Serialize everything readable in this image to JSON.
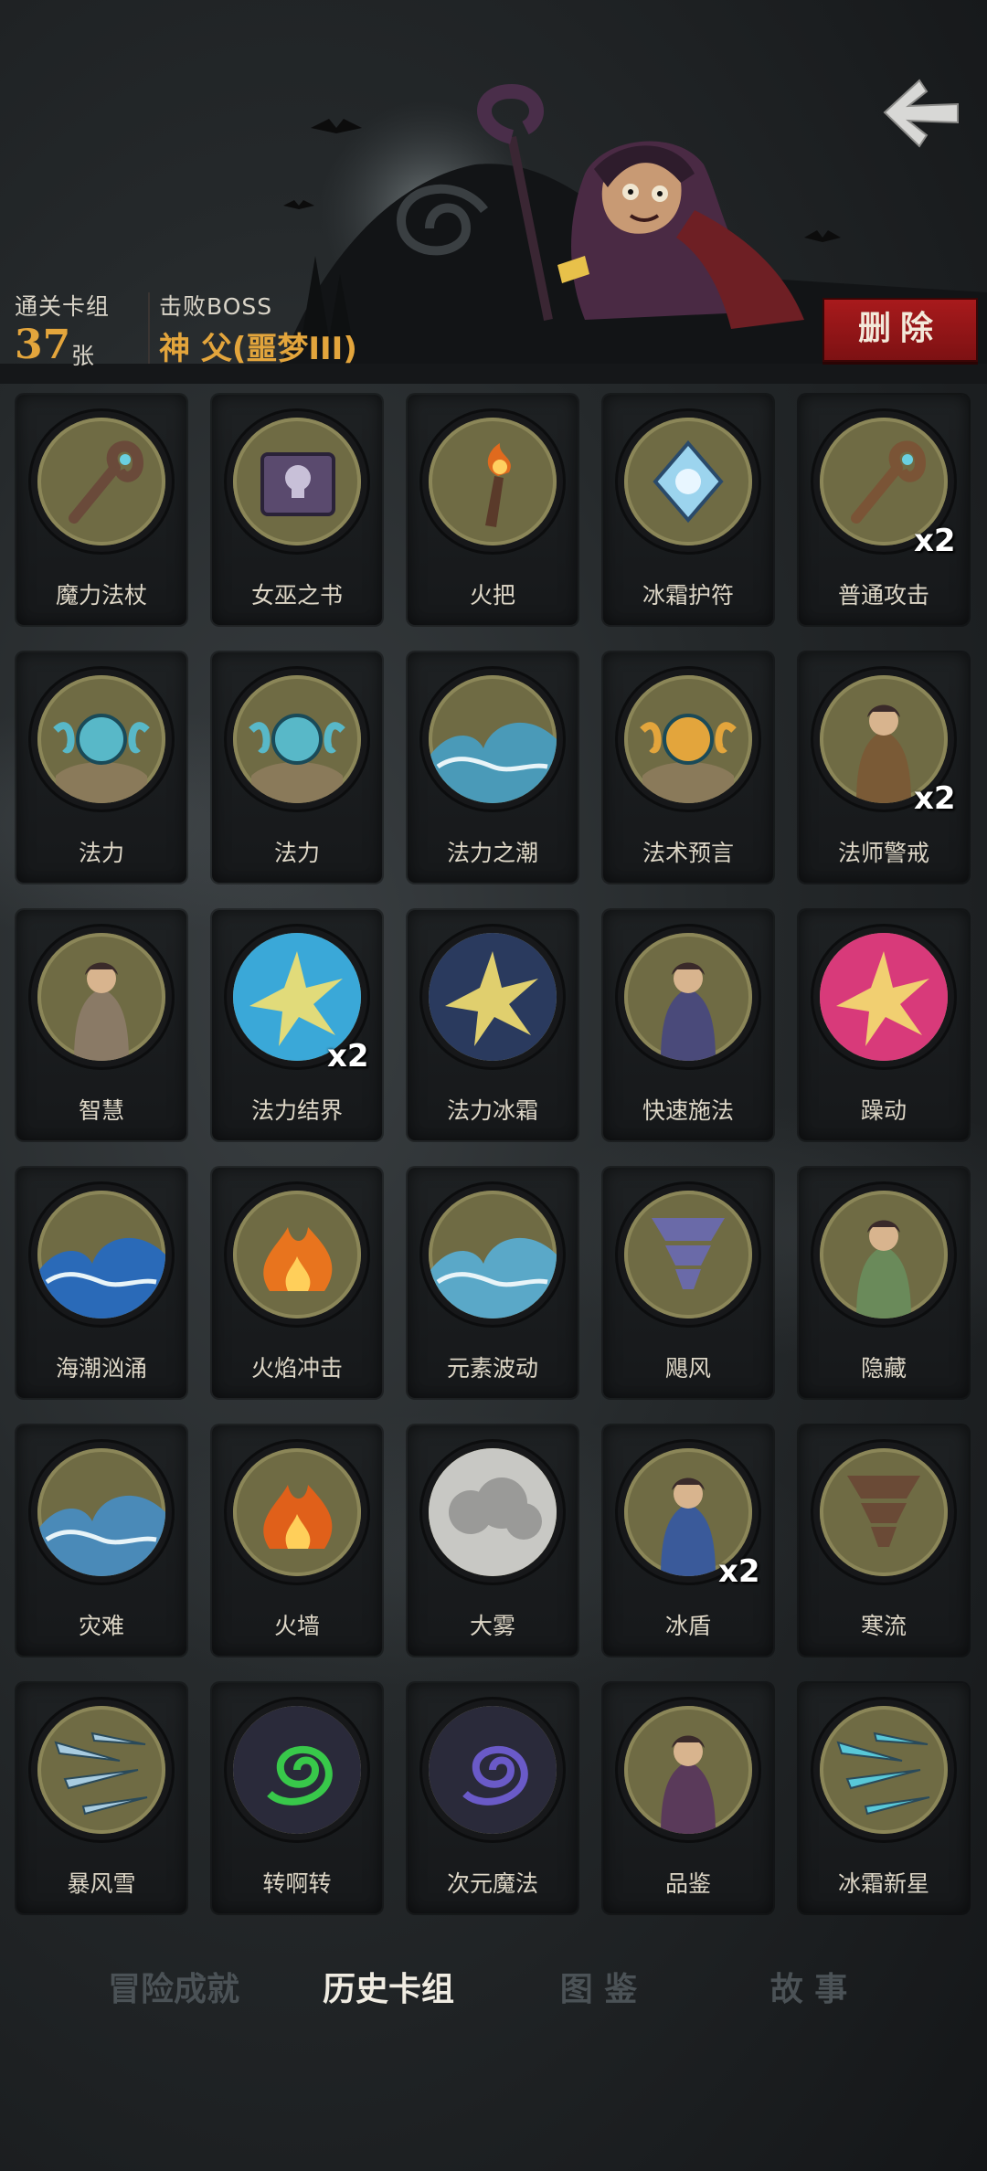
{
  "header": {
    "deck_label": "通关卡组",
    "deck_count": "37",
    "deck_unit": "张",
    "boss_label": "击败BOSS",
    "boss_name": "神 父(噩梦III)",
    "delete_label": "删除",
    "back_icon": "back-arrow-icon"
  },
  "colors": {
    "accent_gold": "#e3a53c",
    "delete_red": "#a81a1c",
    "card_disk": "#6f6b44"
  },
  "cards": [
    {
      "label": "魔力法杖",
      "count": "",
      "art": "staff",
      "color": "#6a4a3a"
    },
    {
      "label": "女巫之书",
      "count": "",
      "art": "book",
      "color": "#5a4a6e"
    },
    {
      "label": "火把",
      "count": "",
      "art": "torch",
      "color": "#e06a1e"
    },
    {
      "label": "冰霜护符",
      "count": "",
      "art": "amulet",
      "color": "#9cd4ee"
    },
    {
      "label": "普通攻击",
      "count": "x2",
      "art": "staff",
      "color": "#7a5436"
    },
    {
      "label": "法力",
      "count": "",
      "art": "orb",
      "color": "#58b8c8"
    },
    {
      "label": "法力",
      "count": "",
      "art": "orb",
      "color": "#58b8c8"
    },
    {
      "label": "法力之潮",
      "count": "",
      "art": "wave",
      "color": "#4a9ab8"
    },
    {
      "label": "法术预言",
      "count": "",
      "art": "orb",
      "color": "#e3a53c"
    },
    {
      "label": "法师警戒",
      "count": "x2",
      "art": "figure",
      "color": "#7a5a36"
    },
    {
      "label": "智慧",
      "count": "",
      "art": "figure",
      "color": "#8a7a66"
    },
    {
      "label": "法力结界",
      "count": "x2",
      "art": "burst",
      "color": "#3aa8d8"
    },
    {
      "label": "法力冰霜",
      "count": "",
      "art": "burst",
      "color": "#2a3a5e"
    },
    {
      "label": "快速施法",
      "count": "",
      "art": "figure",
      "color": "#4a4a7a"
    },
    {
      "label": "躁动",
      "count": "",
      "art": "burst",
      "color": "#d83a7a"
    },
    {
      "label": "海潮汹涌",
      "count": "",
      "art": "wave",
      "color": "#2a6ab8"
    },
    {
      "label": "火焰冲击",
      "count": "",
      "art": "flame",
      "color": "#e8741e"
    },
    {
      "label": "元素波动",
      "count": "",
      "art": "wave",
      "color": "#5aa8c8"
    },
    {
      "label": "飓风",
      "count": "",
      "art": "tornado",
      "color": "#6a6aa8"
    },
    {
      "label": "隐藏",
      "count": "",
      "art": "figure",
      "color": "#6a8a5a"
    },
    {
      "label": "灾难",
      "count": "",
      "art": "wave",
      "color": "#4a8ab8"
    },
    {
      "label": "火墙",
      "count": "",
      "art": "flame",
      "color": "#e0601a"
    },
    {
      "label": "大雾",
      "count": "",
      "art": "cloud",
      "color": "#9a9a98"
    },
    {
      "label": "冰盾",
      "count": "x2",
      "art": "figure",
      "color": "#3a5a9a"
    },
    {
      "label": "寒流",
      "count": "",
      "art": "tornado",
      "color": "#6a4a36"
    },
    {
      "label": "暴风雪",
      "count": "",
      "art": "shards",
      "color": "#a8cce0"
    },
    {
      "label": "转啊转",
      "count": "",
      "art": "swirl",
      "color": "#38c84a"
    },
    {
      "label": "次元魔法",
      "count": "",
      "art": "swirl",
      "color": "#6a5ac8"
    },
    {
      "label": "品鉴",
      "count": "",
      "art": "figure",
      "color": "#5a3a5a"
    },
    {
      "label": "冰霜新星",
      "count": "",
      "art": "shards",
      "color": "#58c8d8"
    }
  ],
  "tabs": [
    {
      "label": "冒险成就",
      "active": false
    },
    {
      "label": "历史卡组",
      "active": true
    },
    {
      "label": "图 鉴",
      "active": false
    },
    {
      "label": "故 事",
      "active": false
    }
  ]
}
